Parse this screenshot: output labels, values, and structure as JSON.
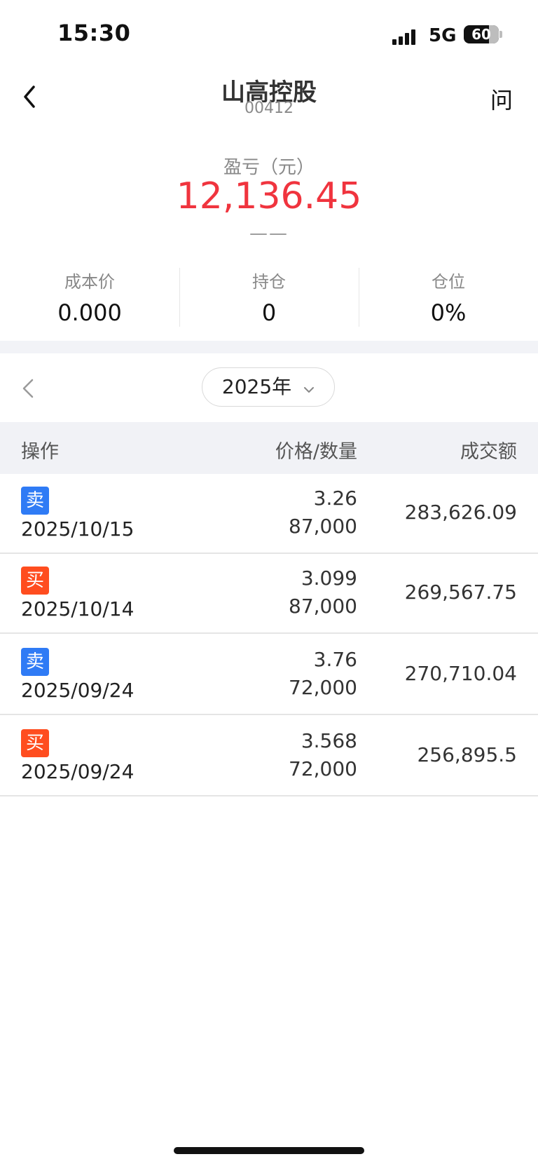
{
  "status_bar": {
    "time": "15:30",
    "network": "5G",
    "battery": "60"
  },
  "header": {
    "title": "山高控股",
    "code": "00412",
    "ask_label": "问"
  },
  "pnl": {
    "label": "盈亏（元）",
    "value": "12,136.45",
    "sub": "——"
  },
  "stats": [
    {
      "label": "成本价",
      "value": "0.000"
    },
    {
      "label": "持仓",
      "value": "0"
    },
    {
      "label": "仓位",
      "value": "0%"
    }
  ],
  "year_selector": {
    "value": "2025年"
  },
  "table": {
    "headers": {
      "operation": "操作",
      "price_qty": "价格/数量",
      "amount": "成交额"
    },
    "rows": [
      {
        "side": "卖",
        "date": "2025/10/15",
        "price": "3.26",
        "qty": "87,000",
        "amount": "283,626.09"
      },
      {
        "side": "买",
        "date": "2025/10/14",
        "price": "3.099",
        "qty": "87,000",
        "amount": "269,567.75"
      },
      {
        "side": "卖",
        "date": "2025/09/24",
        "price": "3.76",
        "qty": "72,000",
        "amount": "270,710.04"
      },
      {
        "side": "买",
        "date": "2025/09/24",
        "price": "3.568",
        "qty": "72,000",
        "amount": "256,895.5"
      }
    ]
  },
  "colors": {
    "sell": "#2f7bf5",
    "buy": "#ff4d1f",
    "profit": "#f0343e"
  }
}
